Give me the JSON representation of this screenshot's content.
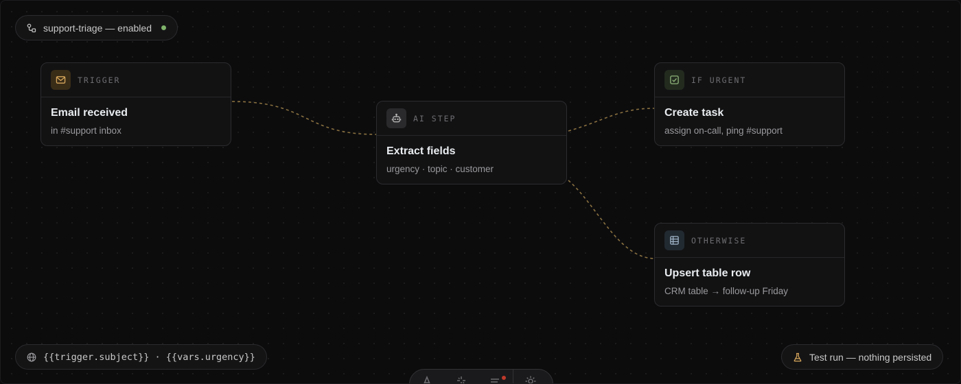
{
  "workflow_status": {
    "icon": "workflow-icon",
    "label": "support-triage — enabled",
    "status_color": "#7fb36a"
  },
  "nodes": {
    "trigger": {
      "icon": "mail-icon",
      "kind": "TRIGGER",
      "title": "Email received",
      "subtitle": "in #support inbox",
      "accent": "#d9a85c"
    },
    "ai_step": {
      "icon": "bot-icon",
      "kind": "AI STEP",
      "title": "Extract fields",
      "subtitle": "urgency · topic · customer",
      "accent": "#a8a8a8"
    },
    "if_urgent": {
      "icon": "check-square-icon",
      "kind": "IF URGENT",
      "title": "Create task",
      "subtitle": "assign on-call, ping #support",
      "accent": "#8fb57a"
    },
    "otherwise": {
      "icon": "table-icon",
      "kind": "OTHERWISE",
      "title": "Upsert table row",
      "subtitle": "CRM table → follow-up Friday",
      "accent": "#9fb4c8"
    }
  },
  "expression_bar": {
    "icon": "globe-icon",
    "text": "{{trigger.subject}} · {{vars.urgency}}"
  },
  "test_run": {
    "icon": "flask-icon",
    "label": "Test run — nothing persisted",
    "accent": "#d9a85c"
  },
  "toolbar": {
    "tools": [
      "text-tool-icon",
      "sparkle-tool-icon",
      "list-tool-icon",
      "settings-tool-icon"
    ],
    "notification_color": "#c0392b"
  },
  "connector_color": "#8a7140"
}
